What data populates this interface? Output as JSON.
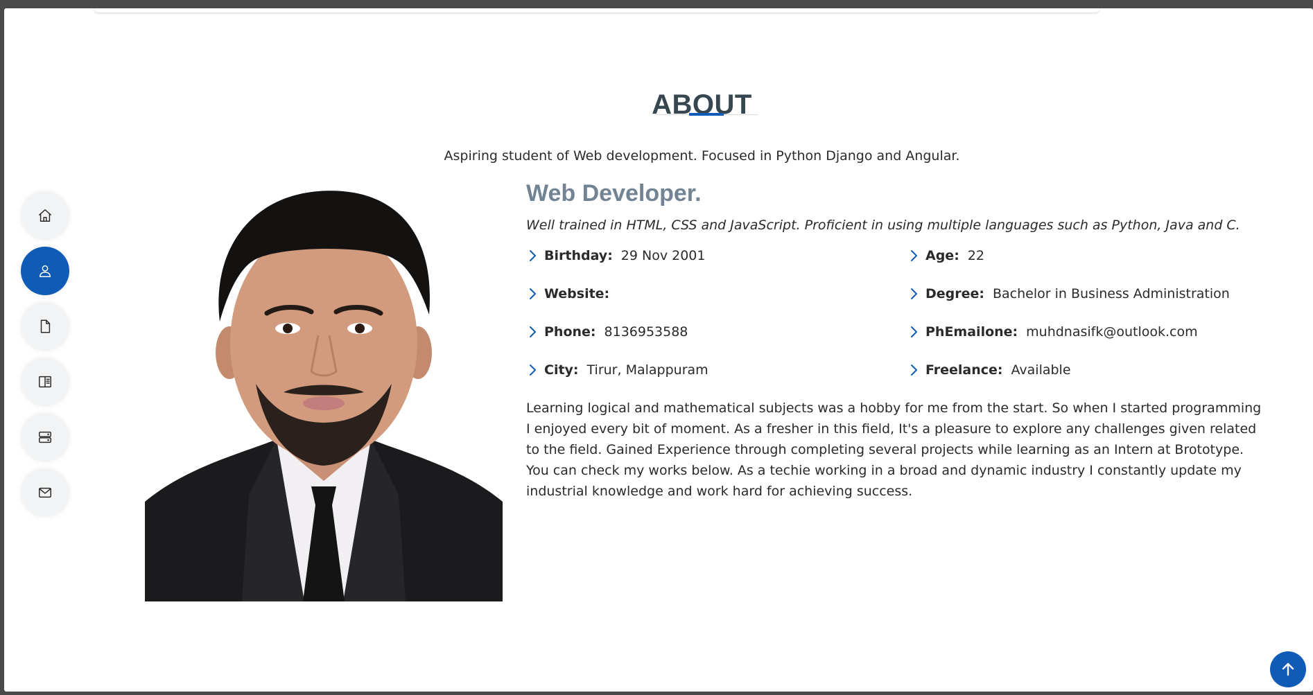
{
  "section": {
    "title": "ABOUT",
    "subtitle": "Aspiring student of Web development. Focused in Python Django and Angular."
  },
  "sidebar": {
    "items": [
      {
        "name": "home",
        "icon": "home-icon",
        "active": false
      },
      {
        "name": "about",
        "icon": "user-icon",
        "active": true
      },
      {
        "name": "resume",
        "icon": "file-icon",
        "active": false
      },
      {
        "name": "portfolio",
        "icon": "book-icon",
        "active": false
      },
      {
        "name": "services",
        "icon": "server-icon",
        "active": false
      },
      {
        "name": "contact",
        "icon": "envelope-icon",
        "active": false
      }
    ]
  },
  "profile": {
    "role": "Web Developer.",
    "tagline": "Well trained in HTML, CSS and JavaScript. Proficient in using multiple languages such as Python, Java and C.",
    "facts": {
      "birthday": {
        "label": "Birthday:",
        "value": "29 Nov 2001"
      },
      "age": {
        "label": "Age:",
        "value": "22"
      },
      "website": {
        "label": "Website:",
        "value": ""
      },
      "degree": {
        "label": "Degree:",
        "value": "Bachelor in Business Administration"
      },
      "phone": {
        "label": "Phone:",
        "value": "8136953588"
      },
      "email": {
        "label": "PhEmailone:",
        "value": "muhdnasifk@outlook.com"
      },
      "city": {
        "label": "City:",
        "value": "Tirur, Malappuram"
      },
      "freelance": {
        "label": "Freelance:",
        "value": "Available"
      }
    },
    "bio": "Learning logical and mathematical subjects was a hobby for me from the start. So when I started programming I enjoyed every bit of moment. As a fresher in this field, It's a pleasure to explore any challenges given related to the field. Gained Experience through completing several projects while learning as an Intern at Brototype. You can check my works below. As a techie working in a broad and dynamic industry I constantly update my industrial knowledge and work hard for achieving success."
  },
  "colors": {
    "accent": "#0f5bb5",
    "heading": "#37474f",
    "role": "#728394",
    "text": "#2a2a2a"
  },
  "back_to_top": {
    "icon": "arrow-up-icon"
  }
}
